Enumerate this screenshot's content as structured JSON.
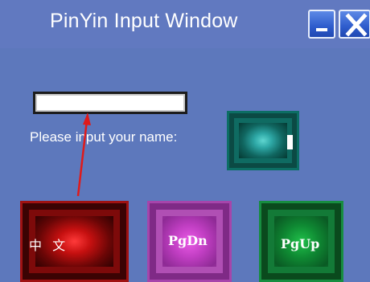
{
  "window": {
    "title": "PinYin Input Window",
    "minimize_icon": "minimize-icon",
    "close_icon": "close-icon"
  },
  "form": {
    "name_value": "",
    "prompt": "Please input your name:"
  },
  "buttons": {
    "chinese_label": "中 文",
    "pgdn_label": "PgDn",
    "pgup_label": "PgUp",
    "confirm_icon": "cursor-bar-icon"
  },
  "annotation": {
    "arrow_icon": "red-arrow-icon",
    "arrow_color": "#e01a1a"
  },
  "colors": {
    "background": "#5d78bc",
    "chinese_button": "#c61010",
    "pgdn_button": "#c03ec2",
    "pgup_button": "#0f8a33",
    "teal_button": "#2ea8a6"
  }
}
